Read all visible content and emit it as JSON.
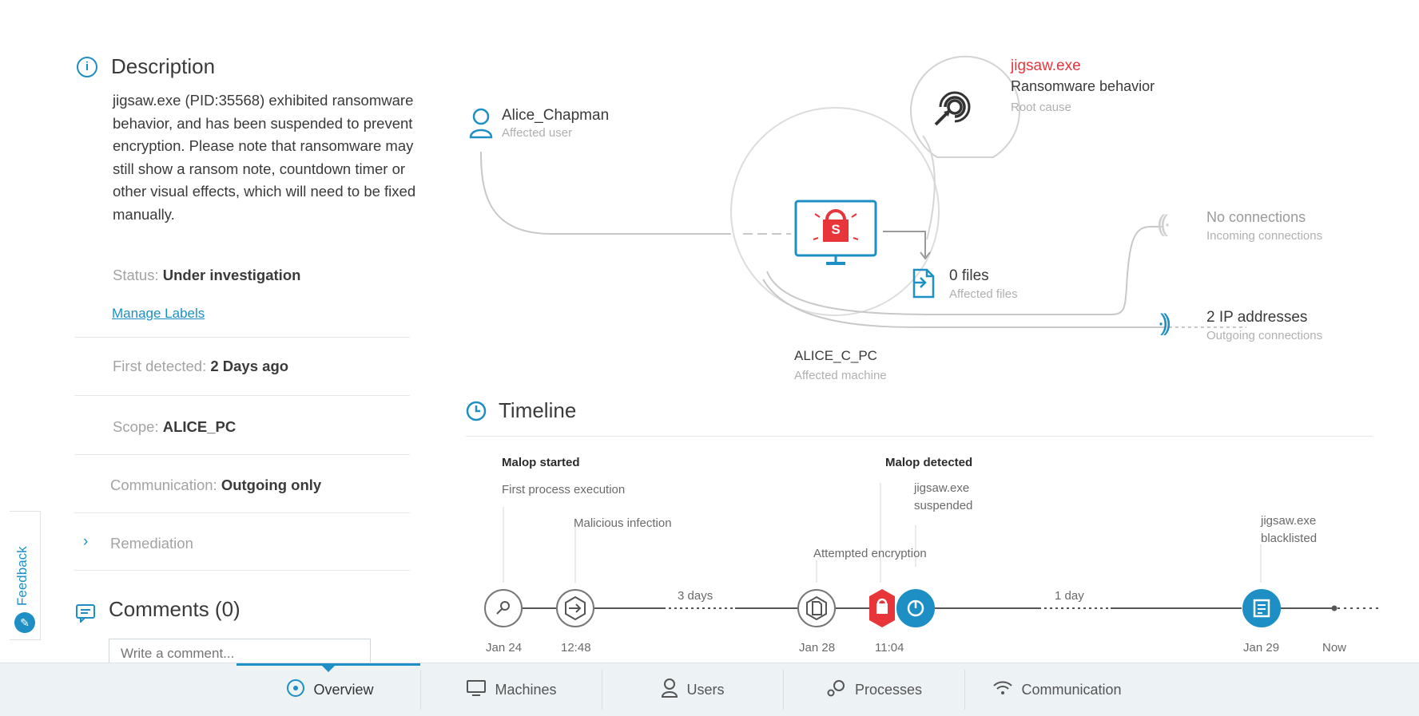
{
  "description": {
    "title": "Description",
    "text": "jigsaw.exe (PID:35568) exhibited ransomware behavior, and has been suspended to prevent encryption. Please note that ransomware may still show a ransom note, countdown timer or other visual effects, which will need to be fixed manually.",
    "status_label": "Status:",
    "status_value": "Under investigation",
    "manage_labels": "Manage Labels",
    "first_detected_label": "First detected:",
    "first_detected_value": "2 Days ago",
    "scope_label": "Scope:",
    "scope_value": "ALICE_PC",
    "communication_label": "Communication:",
    "communication_value": "Outgoing only",
    "remediation": "Remediation"
  },
  "comments": {
    "title": "Comments (0)",
    "placeholder": "Write a comment..."
  },
  "feedback": "Feedback",
  "graph": {
    "user_name": "Alice_Chapman",
    "user_sub": "Affected user",
    "root_name": "jigsaw.exe",
    "root_desc": "Ransomware behavior",
    "root_sub": "Root cause",
    "files_title": "0 files",
    "files_sub": "Affected files",
    "machine_name": "ALICE_C_PC",
    "machine_sub": "Affected machine",
    "incoming_title": "No connections",
    "incoming_sub": "Incoming connections",
    "outgoing_title": "2 IP addresses",
    "outgoing_sub": "Outgoing connections",
    "screen_glyph": "S"
  },
  "timeline": {
    "title": "Timeline",
    "malop_started": "Malop started",
    "first_process": "First process execution",
    "malicious_infection": "Malicious infection",
    "gap1": "3 days",
    "attempted_encryption": "Attempted encryption",
    "malop_detected": "Malop detected",
    "suspended_1": "jigsaw.exe",
    "suspended_2": "suspended",
    "gap2": "1 day",
    "blacklisted_1": "jigsaw.exe",
    "blacklisted_2": "blacklisted",
    "date1": "Jan 24",
    "time1": "12:48",
    "date2": "Jan 28",
    "time2": "11:04",
    "date3": "Jan 29",
    "now": "Now"
  },
  "nav": {
    "overview": "Overview",
    "machines": "Machines",
    "users": "Users",
    "processes": "Processes",
    "communication": "Communication"
  },
  "colors": {
    "accent": "#1d8fc4",
    "danger": "#e8353a"
  }
}
